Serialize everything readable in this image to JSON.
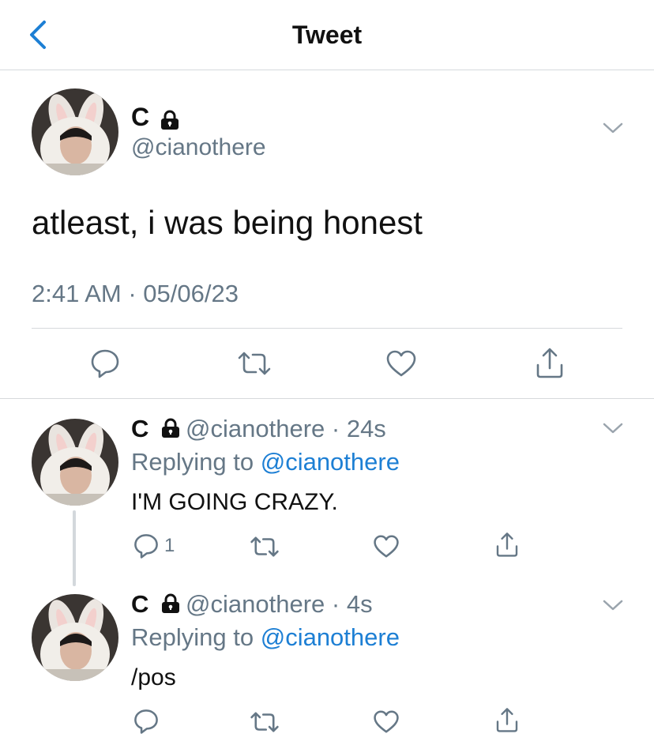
{
  "nav": {
    "title": "Tweet"
  },
  "tweet": {
    "author_name": "C",
    "handle": "@cianothere",
    "text": "atleast, i was being honest",
    "timestamp": "2:41 AM · 05/06/23"
  },
  "replies": [
    {
      "author_name": "C",
      "handle": "@cianothere",
      "time": "· 24s",
      "replying_prefix": "Replying to",
      "replying_to": "@cianothere",
      "text": "I'M GOING CRAZY.",
      "reply_count": "1"
    },
    {
      "author_name": "C",
      "handle": "@cianothere",
      "time": "· 4s",
      "replying_prefix": "Replying to",
      "replying_to": "@cianothere",
      "text": "/pos",
      "reply_count": ""
    }
  ],
  "icons": {
    "back": "chevron-left-icon",
    "lock": "lock-icon",
    "more": "chevron-down-icon",
    "reply": "reply-icon",
    "retweet": "retweet-icon",
    "like": "heart-icon",
    "share": "share-icon"
  },
  "colors": {
    "accent": "#1d7fd4",
    "secondary_text": "#657786",
    "divider": "#d6d9dc"
  }
}
